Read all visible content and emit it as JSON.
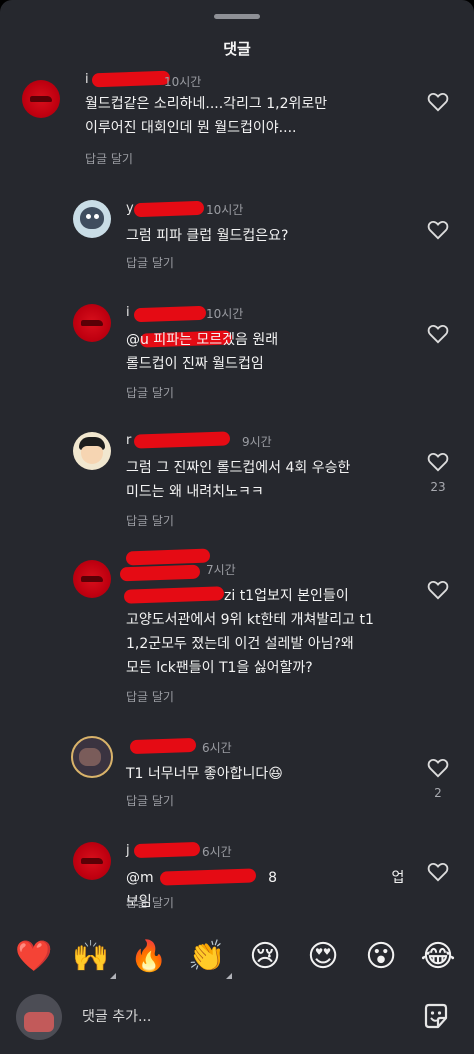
{
  "header": {
    "title": "댓글"
  },
  "comments": [
    {
      "user": "i",
      "time": "10시간",
      "text": "월드컵같은 소리하네....각리그 1,2위로만\n이루어진 대회인데 뭔 월드컵이야....",
      "reply": "답글 달기",
      "likes": ""
    },
    {
      "user": "y",
      "time": "10시간",
      "text": "그럼 피파 클럽 월드컵은요?",
      "reply": "답글 달기",
      "likes": ""
    },
    {
      "user": "i",
      "time": "10시간",
      "text": "@u 피파는 모르겠음 원래\n롤드컵이 진짜 월드컵임",
      "reply": "답글 달기",
      "likes": ""
    },
    {
      "user": "r",
      "time": "9시간",
      "text": "그럼 그 진짜인 롤드컵에서 4회 우승한\n미드는 왜 내려치노ㅋㅋ",
      "reply": "답글 달기",
      "likes": "23"
    },
    {
      "user": "",
      "time": "7시간",
      "text": "zi t1업보지 본인들이\n고양도서관에서 9위 kt한테 개쳐발리고 t1\n1,2군모두 졌는데 이건 설레발 아님?왜\n모든 lck팬들이 T1을 싫어할까?",
      "reply": "답글 달기",
      "likes": ""
    },
    {
      "user": "",
      "time": "6시간",
      "text": "T1 너무너무 좋아합니다😆",
      "reply": "답글 달기",
      "likes": "2"
    },
    {
      "user": "j",
      "time": "6시간",
      "text": "@m 8 업보임",
      "reply": "답글 달기",
      "likes": ""
    }
  ],
  "emojis": [
    "❤️",
    "🙌",
    "🔥",
    "👏",
    "😢",
    "😍",
    "😮",
    "😂"
  ],
  "input": {
    "placeholder": "댓글 추가..."
  },
  "icons": {
    "like": "heart-outline-icon",
    "sticker": "sticker-icon"
  }
}
